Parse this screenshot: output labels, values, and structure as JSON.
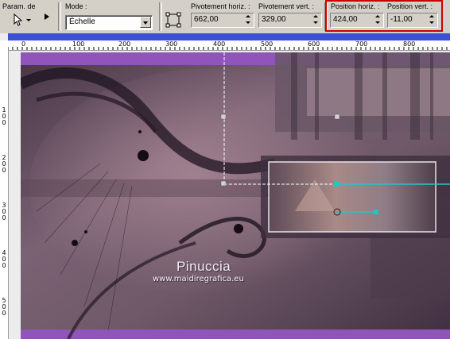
{
  "toolbar": {
    "preset_label": "Param. de",
    "mode_label": "Mode :",
    "mode_value": "Échelle",
    "pivot_h_label": "Pivotement horiz. :",
    "pivot_h_value": "662,00",
    "pivot_v_label": "Pivotement vert. :",
    "pivot_v_value": "329,00",
    "pos_h_label": "Position horiz. :",
    "pos_h_value": "424,00",
    "pos_v_label": "Position vert. :",
    "pos_v_value": "-11,00"
  },
  "ruler": {
    "top_ticks": [
      "0",
      "100",
      "200",
      "300",
      "400",
      "500",
      "600",
      "700",
      "800"
    ],
    "left_ticks": [
      "1\n0\n0",
      "2\n0\n0",
      "3\n0\n0",
      "4\n0\n0",
      "5\n0\n0"
    ]
  },
  "canvas": {
    "watermark_title": "Pinuccia",
    "watermark_url": "www.maidiregrafica.eu"
  },
  "icons": {
    "pointer": "arrow-pointer-icon",
    "play": "play-icon",
    "deform": "deform-tool-icon"
  },
  "colors": {
    "toolbar_bg": "#d4d0c8",
    "highlight": "#cc0000",
    "canvas_accent": "#9b59c6"
  }
}
